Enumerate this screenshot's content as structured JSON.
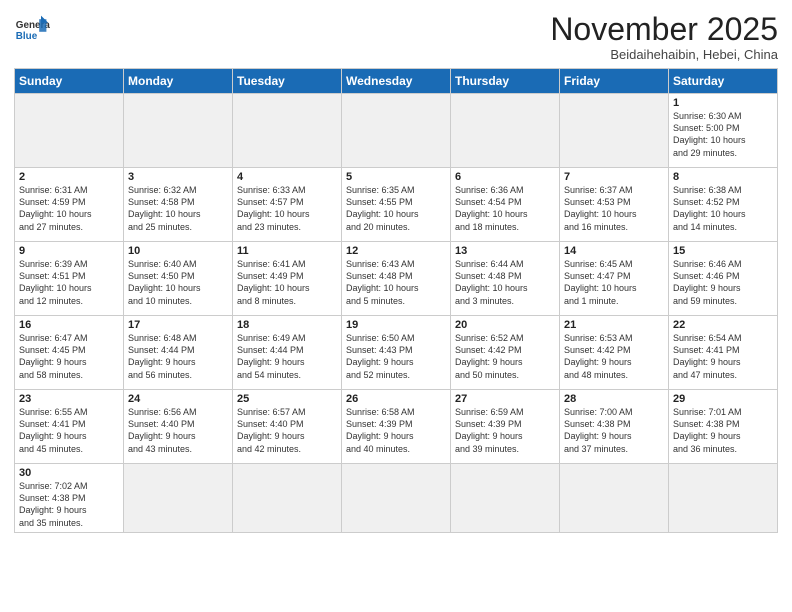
{
  "header": {
    "logo_general": "General",
    "logo_blue": "Blue",
    "month": "November 2025",
    "location": "Beidaihehaibin, Hebei, China"
  },
  "weekdays": [
    "Sunday",
    "Monday",
    "Tuesday",
    "Wednesday",
    "Thursday",
    "Friday",
    "Saturday"
  ],
  "weeks": [
    [
      {
        "day": "",
        "info": "",
        "empty": true
      },
      {
        "day": "",
        "info": "",
        "empty": true
      },
      {
        "day": "",
        "info": "",
        "empty": true
      },
      {
        "day": "",
        "info": "",
        "empty": true
      },
      {
        "day": "",
        "info": "",
        "empty": true
      },
      {
        "day": "",
        "info": "",
        "empty": true
      },
      {
        "day": "1",
        "info": "Sunrise: 6:30 AM\nSunset: 5:00 PM\nDaylight: 10 hours\nand 29 minutes."
      }
    ],
    [
      {
        "day": "2",
        "info": "Sunrise: 6:31 AM\nSunset: 4:59 PM\nDaylight: 10 hours\nand 27 minutes."
      },
      {
        "day": "3",
        "info": "Sunrise: 6:32 AM\nSunset: 4:58 PM\nDaylight: 10 hours\nand 25 minutes."
      },
      {
        "day": "4",
        "info": "Sunrise: 6:33 AM\nSunset: 4:57 PM\nDaylight: 10 hours\nand 23 minutes."
      },
      {
        "day": "5",
        "info": "Sunrise: 6:35 AM\nSunset: 4:55 PM\nDaylight: 10 hours\nand 20 minutes."
      },
      {
        "day": "6",
        "info": "Sunrise: 6:36 AM\nSunset: 4:54 PM\nDaylight: 10 hours\nand 18 minutes."
      },
      {
        "day": "7",
        "info": "Sunrise: 6:37 AM\nSunset: 4:53 PM\nDaylight: 10 hours\nand 16 minutes."
      },
      {
        "day": "8",
        "info": "Sunrise: 6:38 AM\nSunset: 4:52 PM\nDaylight: 10 hours\nand 14 minutes."
      }
    ],
    [
      {
        "day": "9",
        "info": "Sunrise: 6:39 AM\nSunset: 4:51 PM\nDaylight: 10 hours\nand 12 minutes."
      },
      {
        "day": "10",
        "info": "Sunrise: 6:40 AM\nSunset: 4:50 PM\nDaylight: 10 hours\nand 10 minutes."
      },
      {
        "day": "11",
        "info": "Sunrise: 6:41 AM\nSunset: 4:49 PM\nDaylight: 10 hours\nand 8 minutes."
      },
      {
        "day": "12",
        "info": "Sunrise: 6:43 AM\nSunset: 4:48 PM\nDaylight: 10 hours\nand 5 minutes."
      },
      {
        "day": "13",
        "info": "Sunrise: 6:44 AM\nSunset: 4:48 PM\nDaylight: 10 hours\nand 3 minutes."
      },
      {
        "day": "14",
        "info": "Sunrise: 6:45 AM\nSunset: 4:47 PM\nDaylight: 10 hours\nand 1 minute."
      },
      {
        "day": "15",
        "info": "Sunrise: 6:46 AM\nSunset: 4:46 PM\nDaylight: 9 hours\nand 59 minutes."
      }
    ],
    [
      {
        "day": "16",
        "info": "Sunrise: 6:47 AM\nSunset: 4:45 PM\nDaylight: 9 hours\nand 58 minutes."
      },
      {
        "day": "17",
        "info": "Sunrise: 6:48 AM\nSunset: 4:44 PM\nDaylight: 9 hours\nand 56 minutes."
      },
      {
        "day": "18",
        "info": "Sunrise: 6:49 AM\nSunset: 4:44 PM\nDaylight: 9 hours\nand 54 minutes."
      },
      {
        "day": "19",
        "info": "Sunrise: 6:50 AM\nSunset: 4:43 PM\nDaylight: 9 hours\nand 52 minutes."
      },
      {
        "day": "20",
        "info": "Sunrise: 6:52 AM\nSunset: 4:42 PM\nDaylight: 9 hours\nand 50 minutes."
      },
      {
        "day": "21",
        "info": "Sunrise: 6:53 AM\nSunset: 4:42 PM\nDaylight: 9 hours\nand 48 minutes."
      },
      {
        "day": "22",
        "info": "Sunrise: 6:54 AM\nSunset: 4:41 PM\nDaylight: 9 hours\nand 47 minutes."
      }
    ],
    [
      {
        "day": "23",
        "info": "Sunrise: 6:55 AM\nSunset: 4:41 PM\nDaylight: 9 hours\nand 45 minutes."
      },
      {
        "day": "24",
        "info": "Sunrise: 6:56 AM\nSunset: 4:40 PM\nDaylight: 9 hours\nand 43 minutes."
      },
      {
        "day": "25",
        "info": "Sunrise: 6:57 AM\nSunset: 4:40 PM\nDaylight: 9 hours\nand 42 minutes."
      },
      {
        "day": "26",
        "info": "Sunrise: 6:58 AM\nSunset: 4:39 PM\nDaylight: 9 hours\nand 40 minutes."
      },
      {
        "day": "27",
        "info": "Sunrise: 6:59 AM\nSunset: 4:39 PM\nDaylight: 9 hours\nand 39 minutes."
      },
      {
        "day": "28",
        "info": "Sunrise: 7:00 AM\nSunset: 4:38 PM\nDaylight: 9 hours\nand 37 minutes."
      },
      {
        "day": "29",
        "info": "Sunrise: 7:01 AM\nSunset: 4:38 PM\nDaylight: 9 hours\nand 36 minutes."
      }
    ],
    [
      {
        "day": "30",
        "info": "Sunrise: 7:02 AM\nSunset: 4:38 PM\nDaylight: 9 hours\nand 35 minutes."
      },
      {
        "day": "",
        "info": "",
        "empty": true
      },
      {
        "day": "",
        "info": "",
        "empty": true
      },
      {
        "day": "",
        "info": "",
        "empty": true
      },
      {
        "day": "",
        "info": "",
        "empty": true
      },
      {
        "day": "",
        "info": "",
        "empty": true
      },
      {
        "day": "",
        "info": "",
        "empty": true
      }
    ]
  ]
}
